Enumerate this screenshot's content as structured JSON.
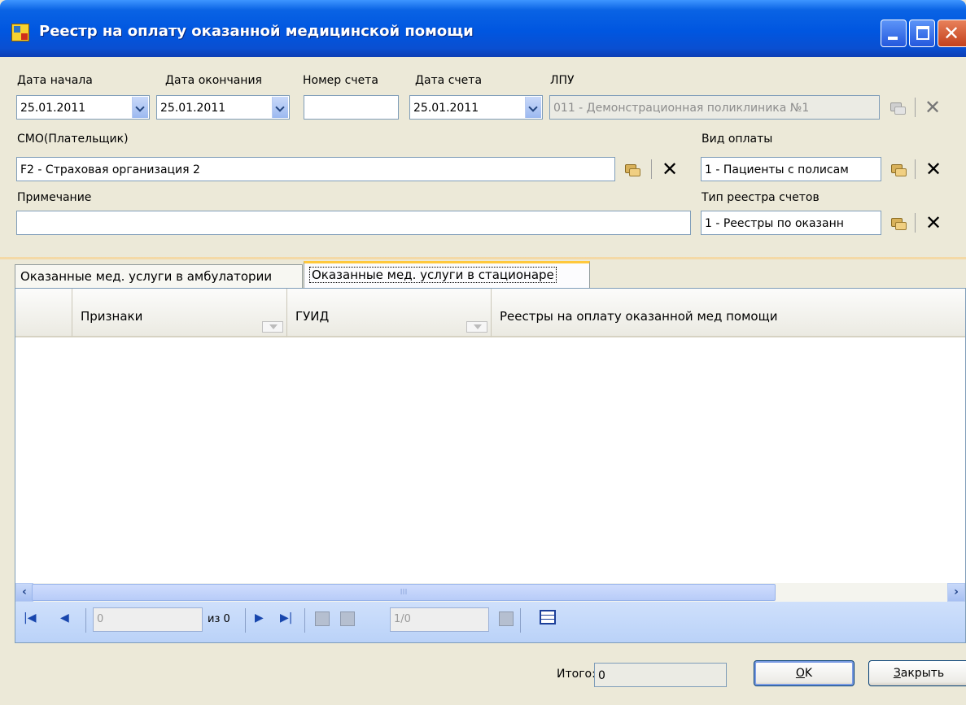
{
  "window": {
    "title": "Реестр на оплату оказанной медицинской помощи",
    "icon": "registry-app-icon"
  },
  "form": {
    "start_date_label": "Дата начала",
    "start_date_value": "25.01.2011",
    "end_date_label": "Дата окончания",
    "end_date_value": "25.01.2011",
    "invoice_number_label": "Номер счета",
    "invoice_number_value": "",
    "invoice_date_label": "Дата счета",
    "invoice_date_value": "25.01.2011",
    "lpu_label": "ЛПУ",
    "lpu_value": "011 - Демонстрационная поликлиника №1",
    "smo_label": "СМО(Плательщик)",
    "smo_value": "F2 - Страховая организация 2",
    "payment_type_label": "Вид оплаты",
    "payment_type_value": "1 - Пациенты с полисам",
    "note_label": "Примечание",
    "note_value": "",
    "registry_type_label": "Тип реестра счетов",
    "registry_type_value": "1 - Реестры по оказанн"
  },
  "tabs": [
    {
      "label": "Оказанные мед. услуги в амбулатории",
      "active": false
    },
    {
      "label": "Оказанные мед. услуги в стационаре",
      "active": true
    }
  ],
  "grid": {
    "columns": [
      "Признаки",
      "ГУИД",
      "Реестры на оплату оказанной мед помощи"
    ],
    "rows": [],
    "scroll_grip": "III"
  },
  "navigator": {
    "position": "0",
    "of_label": "из 0",
    "page": "1/0"
  },
  "footer": {
    "total_label": "Итого:",
    "total_value": "0",
    "ok_label": "OK",
    "ok_underlined": "O",
    "ok_rest": "K",
    "close_underlined": "З",
    "close_rest": "акрыть"
  },
  "colors": {
    "titlebar": "#0a58e0",
    "window_bg": "#ece9d8",
    "tab_accent": "#ffc83c",
    "navbar": "#c6dbfa"
  }
}
